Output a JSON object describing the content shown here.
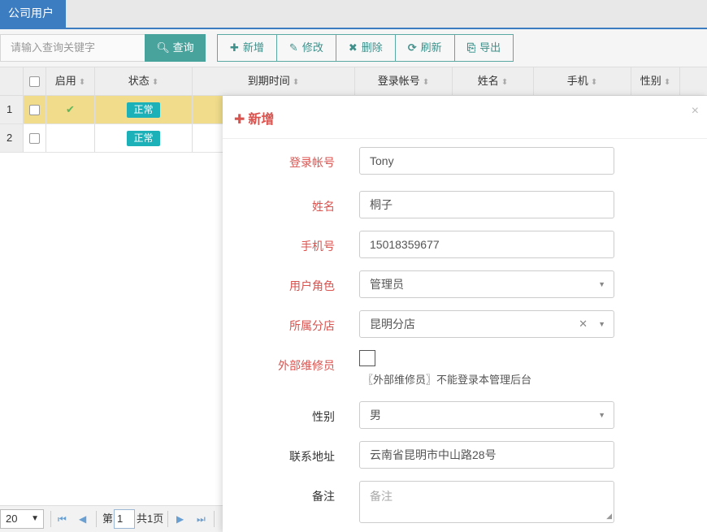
{
  "tab": {
    "label": "公司用户"
  },
  "toolbar": {
    "search_placeholder": "请输入查询关键字",
    "search_button": "查询",
    "buttons": [
      {
        "icon": "plus-icon",
        "glyph": "✚",
        "label": "新增"
      },
      {
        "icon": "edit-icon",
        "glyph": "✎",
        "label": "修改"
      },
      {
        "icon": "delete-icon",
        "glyph": "✖",
        "label": "删除"
      },
      {
        "icon": "refresh-icon",
        "glyph": "⟳",
        "label": "刷新"
      },
      {
        "icon": "export-icon",
        "glyph": "⎘",
        "label": "导出"
      }
    ]
  },
  "grid": {
    "columns": [
      "启用",
      "状态",
      "到期时间",
      "登录帐号",
      "姓名",
      "手机",
      "性别"
    ],
    "rows": [
      {
        "index": "1",
        "enabled": "✔",
        "status": "正常"
      },
      {
        "index": "2",
        "enabled": "",
        "status": "正常"
      }
    ]
  },
  "pager": {
    "page_size": "20",
    "page_prefix": "第",
    "page_number": "1",
    "total_pages": "共1页"
  },
  "modal": {
    "title": "新增",
    "close": "×",
    "fields": {
      "login_account": {
        "label": "登录帐号",
        "value": "Tony"
      },
      "name": {
        "label": "姓名",
        "value": "桐子"
      },
      "phone": {
        "label": "手机号",
        "value": "15018359677"
      },
      "role": {
        "label": "用户角色",
        "value": "管理员"
      },
      "branch": {
        "label": "所属分店",
        "value": "昆明分店"
      },
      "external": {
        "label": "外部维修员",
        "hint": "〖外部维修员〗不能登录本管理后台"
      },
      "gender": {
        "label": "性别",
        "value": "男"
      },
      "address": {
        "label": "联系地址",
        "value": "云南省昆明市中山路28号"
      },
      "remark": {
        "label": "备注",
        "placeholder": "备注"
      }
    }
  },
  "colors": {
    "primary": "#3c7dc2",
    "teal": "#48a39d",
    "badge": "#1cb0b8",
    "required": "#d9534f",
    "selected_row": "#f0dc8a"
  }
}
